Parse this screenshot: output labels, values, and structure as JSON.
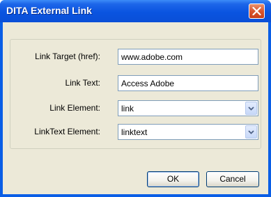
{
  "window": {
    "title": "DITA External Link"
  },
  "form": {
    "link_target": {
      "label": "Link Target (href):",
      "value": "www.adobe.com"
    },
    "link_text": {
      "label": "Link Text:",
      "value": "Access Adobe"
    },
    "link_element": {
      "label": "Link Element:",
      "value": "link"
    },
    "linktext_element": {
      "label": "LinkText Element:",
      "value": "linktext"
    }
  },
  "buttons": {
    "ok": "OK",
    "cancel": "Cancel"
  },
  "icons": {
    "close": "close-icon",
    "dropdown": "chevron-down-icon"
  },
  "colors": {
    "titlebar": "#0a54e0",
    "dialog_bg": "#ece9d8",
    "close_button": "#d9552f"
  }
}
